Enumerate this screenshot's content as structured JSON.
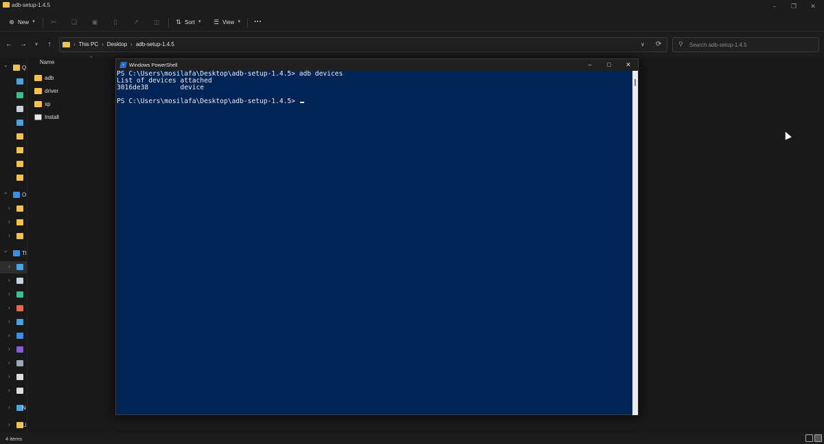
{
  "explorer": {
    "window_title": "adb-setup-1.4.5",
    "toolbar": {
      "new_label": "New",
      "sort_label": "Sort",
      "view_label": "View",
      "more_label": "···"
    },
    "address": {
      "crumbs": [
        "This PC",
        "Desktop",
        "adb-setup-1.4.5"
      ]
    },
    "search": {
      "placeholder": "Search adb-setup-1.4.5"
    },
    "sidebar": {
      "items": [
        {
          "label": "Q",
          "icon": "star-icon",
          "color": "#f2c14e"
        },
        {
          "label": "",
          "icon": "desktop-icon",
          "color": "#4aa3df"
        },
        {
          "label": "",
          "icon": "download-icon",
          "color": "#3fbf8f"
        },
        {
          "label": "",
          "icon": "document-icon",
          "color": "#c8d0e0"
        },
        {
          "label": "",
          "icon": "pictures-icon",
          "color": "#4aa3df"
        },
        {
          "label": "",
          "icon": "folder-icon",
          "color": "#f2c14e"
        },
        {
          "label": "",
          "icon": "folder-icon",
          "color": "#f2c14e"
        },
        {
          "label": "",
          "icon": "folder-icon",
          "color": "#f2c14e"
        },
        {
          "label": "",
          "icon": "folder-icon",
          "color": "#f2c14e"
        },
        {
          "label": "O",
          "icon": "onedrive-icon",
          "color": "#3a8ee6"
        },
        {
          "label": "",
          "icon": "folder-icon",
          "color": "#f2c14e"
        },
        {
          "label": "",
          "icon": "folder-icon",
          "color": "#f2c14e"
        },
        {
          "label": "",
          "icon": "folder-icon",
          "color": "#f2c14e"
        },
        {
          "label": "Tl",
          "icon": "this-pc-icon",
          "color": "#3a8ee6"
        },
        {
          "label": "",
          "icon": "desktop-icon",
          "color": "#4aa3df"
        },
        {
          "label": "",
          "icon": "document-icon",
          "color": "#c8d0e0"
        },
        {
          "label": "",
          "icon": "download-icon",
          "color": "#3fbf8f"
        },
        {
          "label": "",
          "icon": "music-icon",
          "color": "#e06b4a"
        },
        {
          "label": "",
          "icon": "pictures-icon",
          "color": "#4aa3df"
        },
        {
          "label": "",
          "icon": "phone-icon",
          "color": "#3a8ee6"
        },
        {
          "label": "",
          "icon": "videos-icon",
          "color": "#8a5cd6"
        },
        {
          "label": "",
          "icon": "drive-icon",
          "color": "#9ab"
        },
        {
          "label": "",
          "icon": "drive-icon",
          "color": "#ddd"
        },
        {
          "label": "",
          "icon": "drive-icon",
          "color": "#ddd"
        },
        {
          "label": "N",
          "icon": "network-icon",
          "color": "#4aa3df"
        },
        {
          "label": "Li",
          "icon": "linux-icon",
          "color": "#f2c14e"
        }
      ]
    },
    "filelist": {
      "column_name": "Name",
      "files": [
        {
          "name": "adb",
          "type": "folder"
        },
        {
          "name": "driver",
          "type": "folder"
        },
        {
          "name": "xp",
          "type": "folder"
        },
        {
          "name": "Install",
          "type": "cmd"
        }
      ]
    },
    "status": {
      "item_count": "4 items"
    }
  },
  "powershell": {
    "title": "Windows PowerShell",
    "colors": {
      "background": "#012456",
      "text": "#eeedf0"
    },
    "lines": [
      "PS C:\\Users\\mosilafa\\Desktop\\adb-setup-1.4.5> adb devices",
      "List of devices attached",
      "3016de38        device",
      "",
      "PS C:\\Users\\mosilafa\\Desktop\\adb-setup-1.4.5> "
    ]
  }
}
